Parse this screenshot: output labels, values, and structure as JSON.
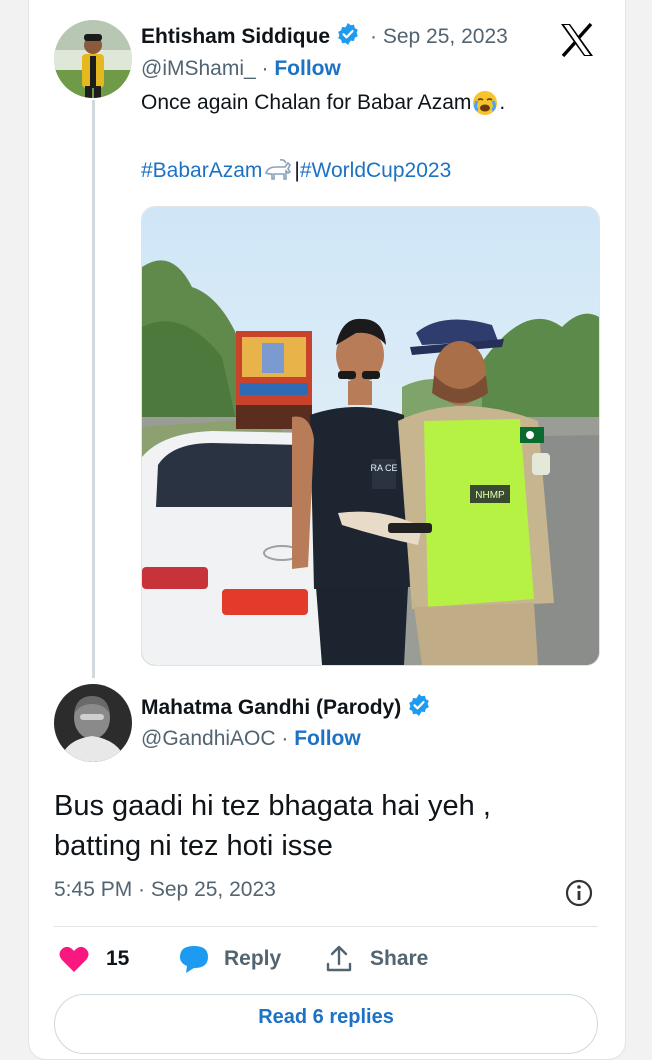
{
  "quoted_tweet": {
    "author_name": "Ehtisham Siddique",
    "date": "· Sep 25, 2023",
    "handle": "@iMShami_",
    "follow_sep": " · ",
    "follow_label": "Follow",
    "text": "Once again Chalan for Babar Azam",
    "text_end": ".",
    "hashtag1": "#BabarAzam",
    "hashtag_sep": " | ",
    "hashtag2": "#WorldCup2023",
    "photo_jersey_text": "RA CE",
    "photo_vest_text": "NHMP"
  },
  "reply_tweet": {
    "author_name": "Mahatma Gandhi (Parody)",
    "handle": "@GandhiAOC",
    "follow_sep": " · ",
    "follow_label": "Follow",
    "text_line1": "Bus gaadi hi tez bhagata hai yeh ,",
    "text_line2": "batting ni tez hoti isse",
    "timestamp": "5:45 PM · Sep 25, 2023"
  },
  "actions": {
    "like_count": "15",
    "reply_label": "Reply",
    "share_label": "Share"
  },
  "read_replies_label": "Read 6 replies",
  "colors": {
    "accent": "#1d72c4",
    "verified": "#1d9bf0",
    "like": "#f91880"
  }
}
